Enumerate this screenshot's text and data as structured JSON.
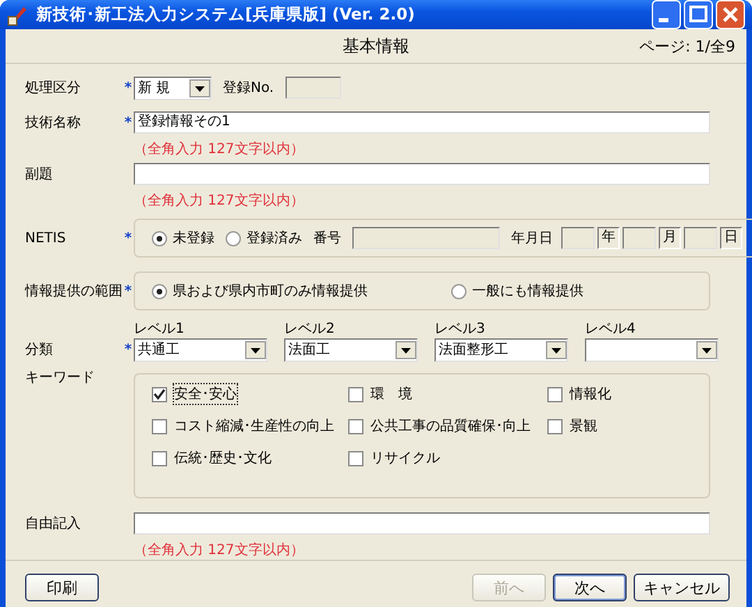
{
  "window": {
    "title": "新技術･新工法入力システム[兵庫県版] (Ver. 2.0)"
  },
  "header": {
    "title": "基本情報",
    "page": "ページ: 1/全9"
  },
  "required_mark": "*",
  "processing": {
    "label": "処理区分",
    "required": true,
    "value": "新 規",
    "reg_label": "登録No."
  },
  "name": {
    "label": "技術名称",
    "required": true,
    "value": "登録情報その1",
    "hint": "（全角入力 127文字以内）"
  },
  "subtitle": {
    "label": "副題",
    "required": false,
    "hint": "（全角入力 127文字以内）"
  },
  "netis": {
    "label": "NETIS",
    "required": true,
    "options": [
      {
        "label": "未登録",
        "selected": true
      },
      {
        "label": "登録済み",
        "selected": false
      }
    ],
    "number_label": "番号",
    "date_label": "年月日",
    "date_units": [
      "年",
      "月",
      "日"
    ]
  },
  "scope": {
    "label": "情報提供の範囲",
    "required": true,
    "options": [
      {
        "label": "県および県内市町のみ情報提供",
        "selected": true
      },
      {
        "label": "一般にも情報提供",
        "selected": false
      }
    ]
  },
  "classification": {
    "label": "分類",
    "required": true,
    "levels": [
      {
        "label": "レベル1",
        "value": "共通工"
      },
      {
        "label": "レベル2",
        "value": "法面工"
      },
      {
        "label": "レベル3",
        "value": "法面整形工"
      },
      {
        "label": "レベル4"
      }
    ]
  },
  "keywords": {
    "label": "キーワード",
    "items": [
      {
        "label": "安全･安心",
        "checked": true
      },
      {
        "label": "環　境",
        "checked": false
      },
      {
        "label": "情報化",
        "checked": false
      },
      {
        "label": "コスト縮減･生産性の向上",
        "checked": false
      },
      {
        "label": "公共工事の品質確保･向上",
        "checked": false
      },
      {
        "label": "景観",
        "checked": false
      },
      {
        "label": "伝統･歴史･文化",
        "checked": false
      },
      {
        "label": "リサイクル",
        "checked": false
      }
    ]
  },
  "free": {
    "label": "自由記入",
    "required": false,
    "hint": "（全角入力 127文字以内）"
  },
  "left_buttons": [
    {
      "label": "印刷",
      "disabled": false,
      "default": false
    }
  ],
  "right_buttons": [
    {
      "label": "前へ",
      "disabled": true,
      "default": false
    },
    {
      "label": "次へ",
      "disabled": false,
      "default": true
    },
    {
      "label": "キャンセル",
      "disabled": false,
      "default": false
    }
  ]
}
